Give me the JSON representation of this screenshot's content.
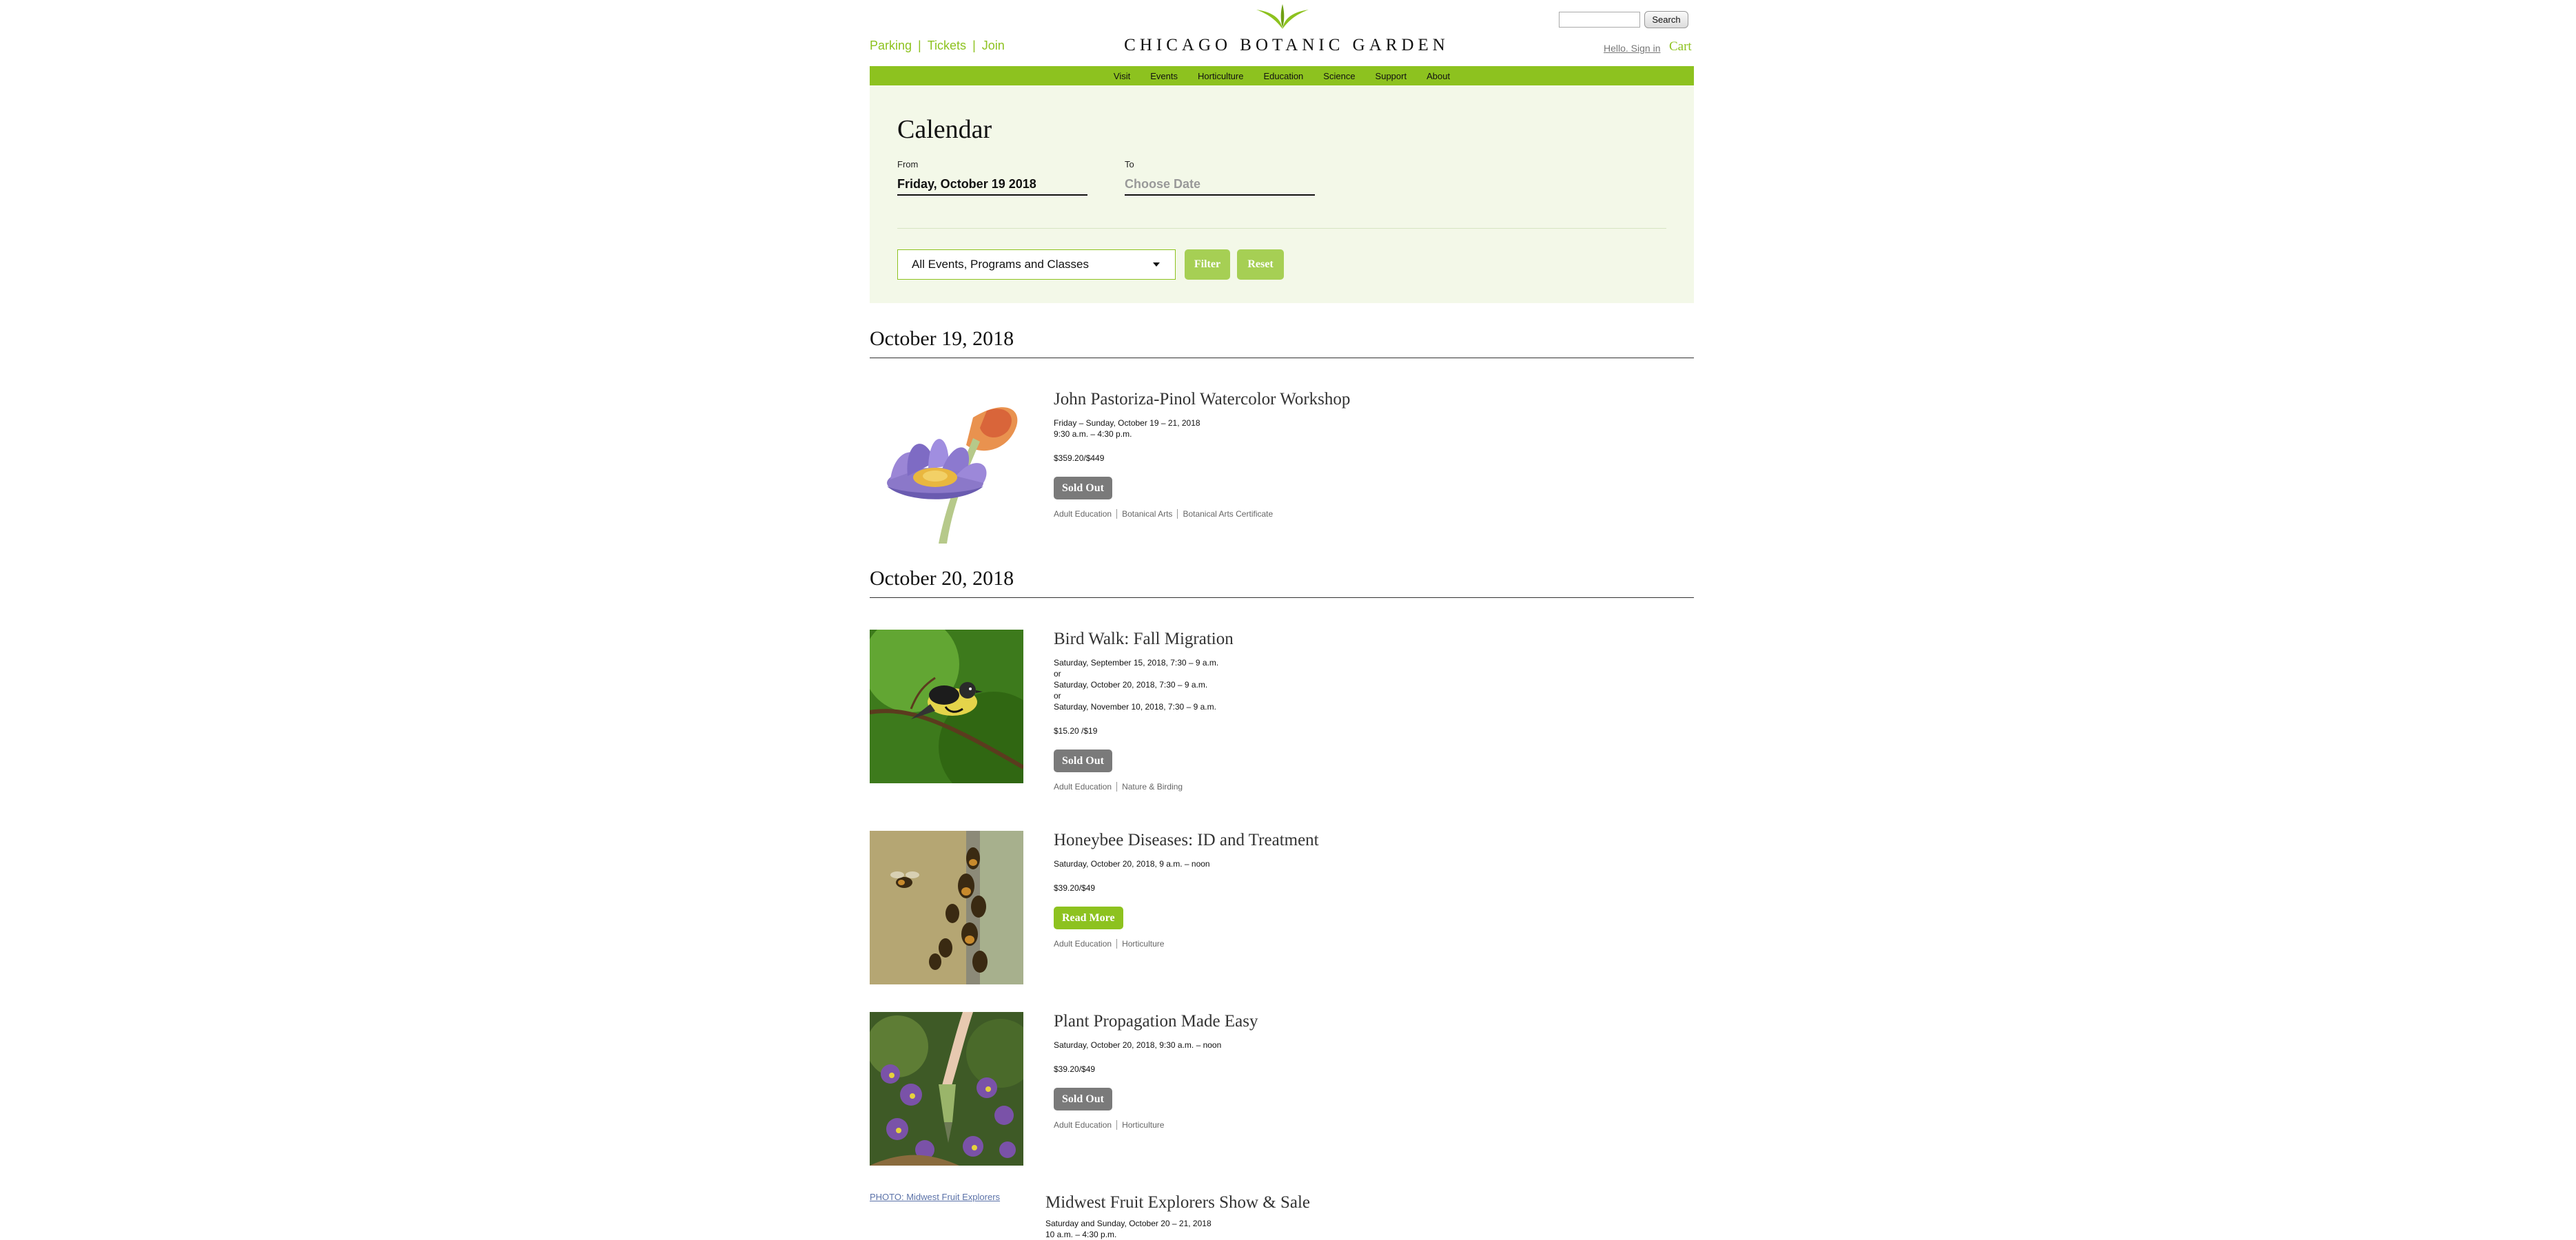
{
  "header": {
    "links": [
      "Parking",
      "Tickets",
      "Join"
    ],
    "logo_text": "CHICAGO BOTANIC GARDEN",
    "search_button": "Search",
    "signin": "Hello. Sign in",
    "cart": "Cart"
  },
  "nav": {
    "items": [
      "Visit",
      "Events",
      "Horticulture",
      "Education",
      "Science",
      "Support",
      "About"
    ]
  },
  "filter": {
    "title": "Calendar",
    "from_label": "From",
    "from_value": "Friday, October 19 2018",
    "to_label": "To",
    "to_placeholder": "Choose Date",
    "select_value": "All Events, Programs and Classes",
    "filter_button": "Filter",
    "reset_button": "Reset"
  },
  "days": [
    {
      "date": "October 19, 2018",
      "events": [
        {
          "title": "John Pastoriza-Pinol Watercolor Workshop",
          "lines": [
            "Friday – Sunday, October 19 – 21, 2018",
            "9:30 a.m. – 4:30 p.m."
          ],
          "price": "$359.20/$449",
          "button": "Sold Out",
          "tags": [
            "Adult Education",
            "Botanical Arts",
            "Botanical Arts Certificate"
          ]
        }
      ]
    },
    {
      "date": "October 20, 2018",
      "events": [
        {
          "title": "Bird Walk: Fall Migration",
          "lines": [
            "Saturday, September 15, 2018, 7:30 – 9 a.m.",
            "or",
            "Saturday, October 20, 2018, 7:30 – 9 a.m.",
            "or",
            "Saturday, November 10, 2018, 7:30 – 9 a.m."
          ],
          "price": "$15.20 /$19",
          "button": "Sold Out",
          "tags": [
            "Adult Education",
            "Nature & Birding"
          ]
        },
        {
          "title": "Honeybee Diseases: ID and Treatment",
          "lines": [
            "Saturday, October 20, 2018, 9 a.m. – noon"
          ],
          "price": "$39.20/$49",
          "button": "Read More",
          "tags": [
            "Adult Education",
            "Horticulture"
          ]
        },
        {
          "title": "Plant Propagation Made Easy",
          "lines": [
            "Saturday, October 20, 2018, 9:30 a.m. – noon"
          ],
          "price": "$39.20/$49",
          "button": "Sold Out",
          "tags": [
            "Adult Education",
            "Horticulture"
          ]
        },
        {
          "title": "Midwest Fruit Explorers Show & Sale",
          "image_alt": "PHOTO: Midwest Fruit Explorers",
          "lines": [
            "Saturday and Sunday, October 20 – 21, 2018",
            "10 a.m. – 4:30 p.m."
          ]
        }
      ]
    }
  ],
  "colors": {
    "accent_green": "#8dc21f",
    "panel_bg": "#f3f8e8",
    "button_green": "#a6cf54",
    "sold_out_gray": "#7a7a7a"
  }
}
